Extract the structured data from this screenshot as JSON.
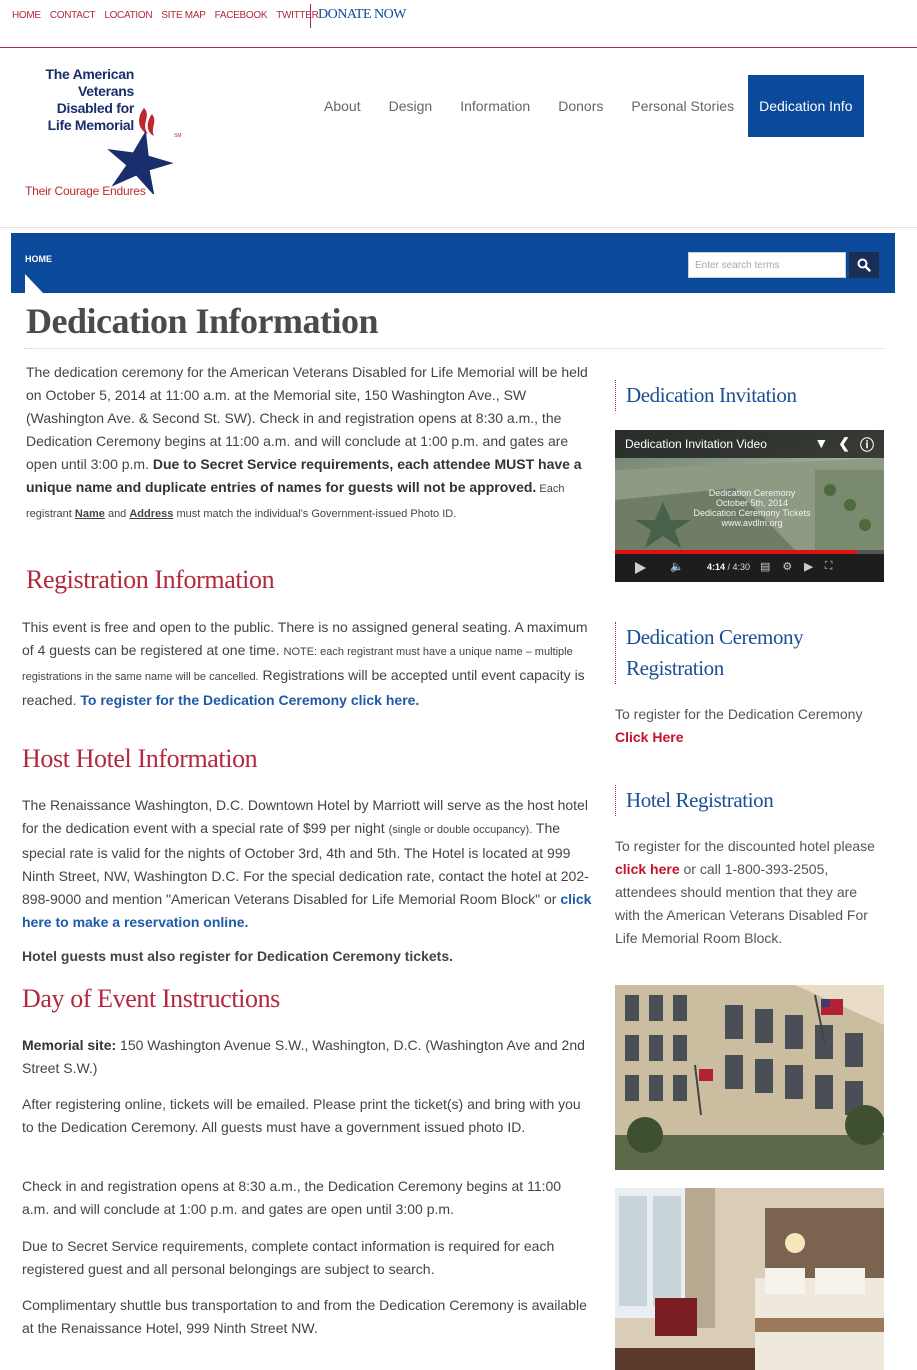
{
  "utility": {
    "links": [
      "HOME",
      "CONTACT",
      "LOCATION",
      "SITE MAP",
      "FACEBOOK",
      "TWITTER"
    ],
    "donate": "DONATE NOW"
  },
  "logo": {
    "line1": "The American",
    "line2": "Veterans",
    "line3": "Disabled for",
    "line4": "Life Memorial",
    "sm": "SM",
    "tagline": "Their Courage Endures"
  },
  "nav": {
    "about": "About",
    "design": "Design",
    "information": "Information",
    "donors": "Donors",
    "stories": "Personal Stories",
    "dedication": "Dedication Info"
  },
  "band": {
    "home": "HOME",
    "search_placeholder": "Enter search terms"
  },
  "page_title": "Dedication Information",
  "intro": {
    "text1": "The dedication ceremony for the American Veterans Disabled for Life Memorial will be held on October 5, 2014 at 11:00 a.m. at the Memorial site, 150 Washington Ave., SW (Washington Ave. & Second St. SW). Check in and registration opens at 8:30 a.m., the Dedication Ceremony begins at 11:00 a.m. and will conclude at 1:00 p.m. and gates are open until 3:00 p.m. ",
    "bold": "Due to Secret Service requirements, each attendee MUST have a unique name and duplicate entries of names for guests will not be approved.",
    "small1": " Each registrant ",
    "name": "Name",
    "and": " and ",
    "address": "Address",
    "small2": " must match the individual’s Government-issued Photo ID."
  },
  "registration": {
    "heading": "Registration Information",
    "text1": "This event is free and open to the public. There is no assigned general seating. A maximum of 4 guests can be registered at one time. ",
    "note": "NOTE: each registrant must have a unique name – multiple registrations in the same name will be cancelled.",
    "text2": " Registrations will be accepted until event capacity is reached. ",
    "link": "To register for the Dedication Ceremony click here."
  },
  "hotel": {
    "heading": "Host Hotel Information",
    "text1": "The Renaissance Washington, D.C. Downtown Hotel by Marriott will serve as the host hotel for the dedication event with a special rate of $99 per night ",
    "small": "(single or double occupancy).",
    "text2": " The special rate is valid for the nights of October 3rd, 4th and 5th. The Hotel is located at 999 Ninth Street, NW, Washington D.C. For the special dedication rate, contact the hotel at 202-898-9000 and mention \"American Veterans Disabled for Life Memorial Room Block\" or ",
    "link": "click here to make a reservation online.",
    "guests": "Hotel guests must also register for Dedication Ceremony tickets."
  },
  "day": {
    "heading": "Day of Event Instructions",
    "site_label": "Memorial site:",
    "site_text": " 150 Washington Avenue S.W., Washington, D.C. (Washington Ave and 2nd Street S.W.)",
    "p2": "After registering online, tickets will be emailed. Please print the ticket(s) and bring with you to the Dedication Ceremony. All guests must have a government issued photo ID.",
    "p3": "Check in and registration opens at 8:30 a.m., the Dedication Ceremony begins at 11:00 a.m. and will conclude at 1:00 p.m. and gates are open until 3:00 p.m.",
    "p4": "Due to Secret Service requirements, complete contact information is required for each registered guest and all personal belongings are subject to search.",
    "p5": "Complimentary shuttle bus transportation to and from the Dedication Ceremony is available at the Renaissance Hotel, 999 Ninth Street NW."
  },
  "sidebar": {
    "invitation_heading": "Dedication Invitation",
    "video": {
      "title": "Dedication Invitation Video",
      "overlay1": "Dedication Ceremony",
      "overlay2": "October 5th, 2014",
      "overlay3": "Dedication Ceremony Tickets",
      "overlay4": "www.avdlm.org",
      "time_current": "4:14",
      "time_total": " / 4:30",
      "progress": 0.9
    },
    "ceremony_heading_1": "Dedication Ceremony",
    "ceremony_heading_2": "Registration",
    "ceremony_text": "To register for the Dedication Ceremony",
    "ceremony_link": "Click Here",
    "hotel_heading": "Hotel Registration",
    "hotel_text1": "To register for the discounted hotel please ",
    "hotel_link": "click here",
    "hotel_text2": " or call 1-800-393-2505, attendees should mention that they are with the American Veterans Disabled For Life Memorial Room Block."
  },
  "colors": {
    "brand_blue": "#0b4a9a",
    "brand_red": "#b3283d",
    "link_blue": "#1e5aa8"
  }
}
